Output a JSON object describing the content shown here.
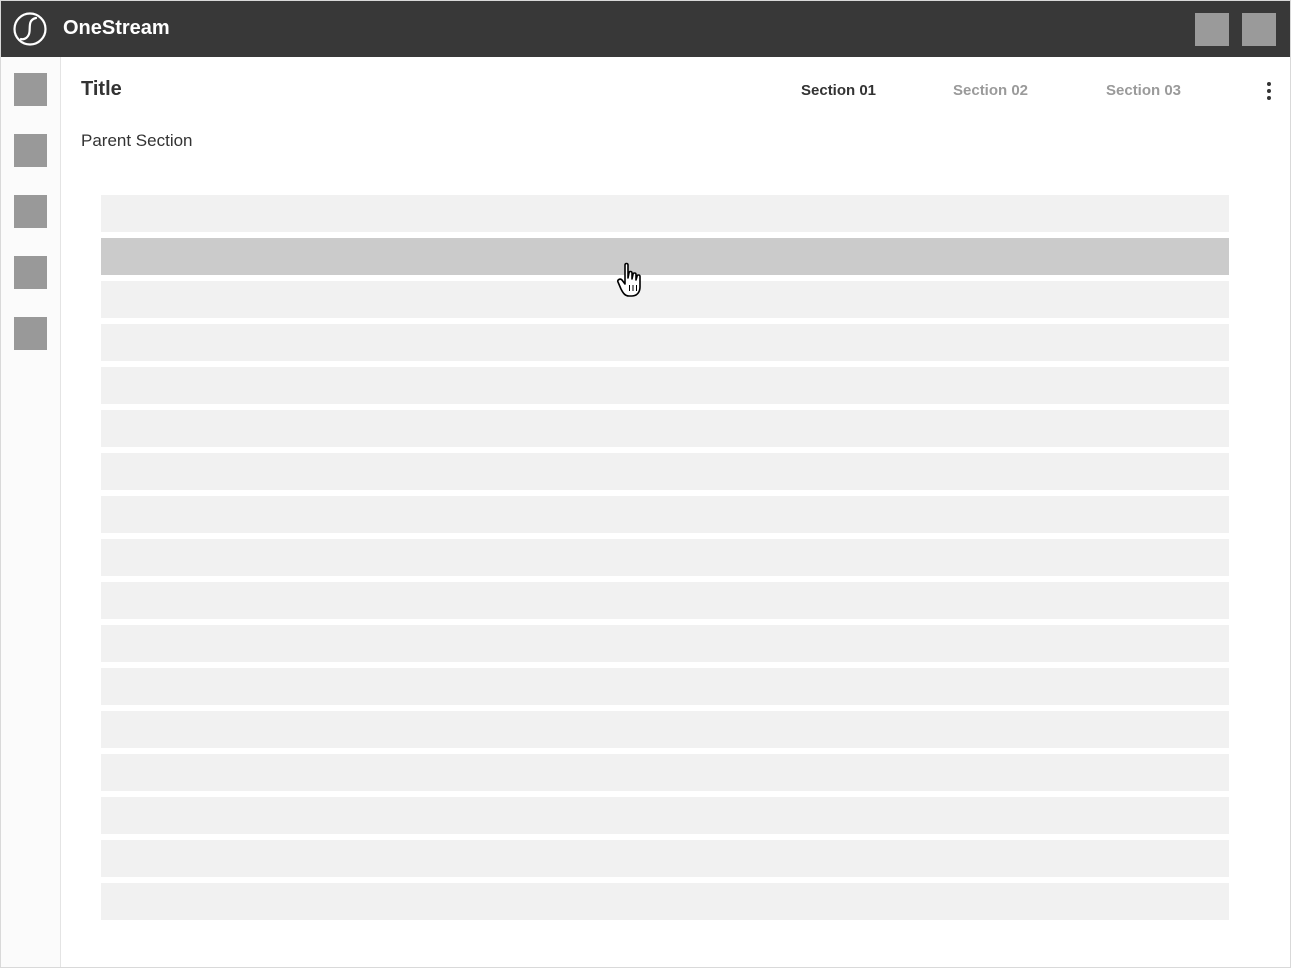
{
  "header": {
    "app_name": "OneStream",
    "logo_icon": "onestream-logo-icon",
    "actions": [
      {
        "icon": "placeholder-square-icon"
      },
      {
        "icon": "placeholder-square-icon"
      }
    ]
  },
  "sidebar": {
    "items": [
      {
        "icon": "placeholder-square-icon"
      },
      {
        "icon": "placeholder-square-icon"
      },
      {
        "icon": "placeholder-square-icon"
      },
      {
        "icon": "placeholder-square-icon"
      },
      {
        "icon": "placeholder-square-icon"
      }
    ]
  },
  "main": {
    "title": "Title",
    "tabs": [
      {
        "label": "Section 01",
        "active": true
      },
      {
        "label": "Section 02",
        "active": false
      },
      {
        "label": "Section 03",
        "active": false
      }
    ],
    "more_icon": "kebab-menu-icon",
    "parent_section": "Parent Section",
    "list": {
      "row_count": 17,
      "hovered_row": 2
    },
    "cursor_icon": "hand-pointer-icon"
  },
  "colors": {
    "topbar": "#383838",
    "placeholder": "#999999",
    "row": "#f1f1f1",
    "row_hover": "#cbcbcb",
    "tab_active": "#333333",
    "tab_inactive": "#9a9a9a"
  }
}
